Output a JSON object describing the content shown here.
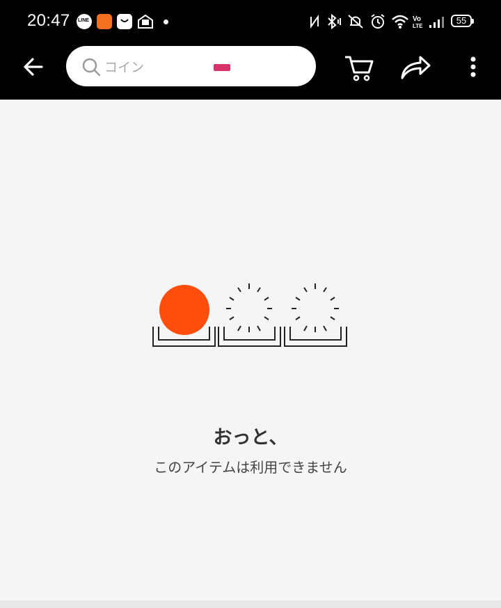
{
  "status_bar": {
    "time": "20:47",
    "battery": "55",
    "notification_icons": [
      "line-icon",
      "app-orange-icon",
      "shopping-bag-icon",
      "mail-icon"
    ],
    "system_icons": [
      "nfc-icon",
      "bluetooth-icon",
      "vibrate-off-icon",
      "alarm-icon",
      "wifi-icon",
      "volte-icon",
      "signal-icon",
      "battery-icon"
    ]
  },
  "app_bar": {
    "search_placeholder": "コイン",
    "icons": [
      "back-arrow-icon",
      "search-icon",
      "ticket-icon",
      "cart-icon",
      "share-icon",
      "more-vert-icon"
    ]
  },
  "colors": {
    "accent": "#ff4d0d",
    "ticket": "#d7336b",
    "background": "#f5f5f5",
    "bar": "#000000"
  },
  "empty_state": {
    "title": "おっと、",
    "message": "このアイテムは利用できません"
  }
}
